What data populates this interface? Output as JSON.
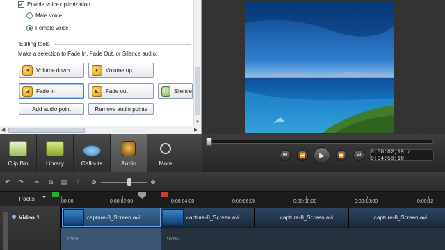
{
  "audio_panel": {
    "enable_voice_optimization": "Enable voice optimization",
    "male_voice": "Male voice",
    "female_voice": "Female voice",
    "editing_tools": "Editing tools",
    "hint": "Make a selection to Fade In, Fade Out, or Silence audio.",
    "buttons": {
      "volume_down": "Volume down",
      "volume_up": "Volume up",
      "fade_in": "Fade in",
      "fade_out": "Fade out",
      "silence": "Silence",
      "add_audio_point": "Add audio point",
      "remove_audio_points": "Remove audio points"
    }
  },
  "task_tabs": [
    {
      "label": "Clip Bin"
    },
    {
      "label": "Library"
    },
    {
      "label": "Callouts"
    },
    {
      "label": "Audio"
    },
    {
      "label": "More"
    }
  ],
  "player": {
    "time": "0:00:02;19 / 0:04:58;10"
  },
  "timeline": {
    "tracks_label": "Tracks",
    "ruler_ticks": [
      "00:00",
      "0:00:02;00",
      "0:00:04;00",
      "0:00:06;00",
      "0:00:08;00",
      "0:00:10;00",
      "0:00:12"
    ],
    "track_name": "Video 1",
    "clips": [
      {
        "label": "capture-8_Screen.avi"
      },
      {
        "label": "capture-8_Screen.avi"
      },
      {
        "label": "capture-8_Screen.avi"
      },
      {
        "label": "capture-8_Screen.avi"
      }
    ],
    "volume_labels": [
      "100%",
      "100%"
    ]
  },
  "colors": {
    "in_marker": "#27b02a",
    "out_marker": "#d13a2a",
    "selected_clip": "#3c6a98"
  }
}
